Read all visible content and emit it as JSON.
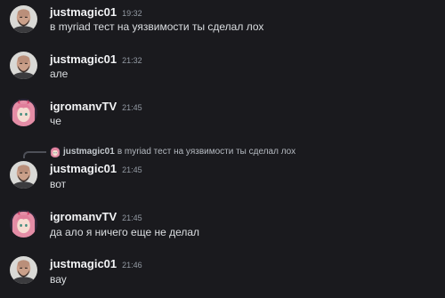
{
  "messages": [
    {
      "author": "justmagic01",
      "time": "19:32",
      "text": "в myriad тест на уязвимости ты сделал лох",
      "avatar": "bald-man-avatar"
    },
    {
      "author": "justmagic01",
      "time": "21:32",
      "text": "але",
      "avatar": "bald-man-avatar"
    },
    {
      "author": "igromanvTV",
      "time": "21:45",
      "text": "че",
      "avatar": "pink-hair-anime-avatar"
    },
    {
      "author": "justmagic01",
      "time": "21:45",
      "text": "вот",
      "avatar": "bald-man-avatar",
      "reply": {
        "author": "justmagic01",
        "text": "в myriad тест на уязвимости ты сделал лох",
        "avatar": "pink-hair-anime-avatar"
      }
    },
    {
      "author": "igromanvTV",
      "time": "21:45",
      "text": "да ало я ничего еще не делал",
      "avatar": "pink-hair-anime-avatar"
    },
    {
      "author": "justmagic01",
      "time": "21:46",
      "text": "вау",
      "avatar": "bald-man-avatar"
    }
  ],
  "colors": {
    "background": "#1a1a1e",
    "username": "#f2f3f5",
    "text": "#dbdee1",
    "timestamp": "#949ba4",
    "reply_line": "#4e5058"
  }
}
